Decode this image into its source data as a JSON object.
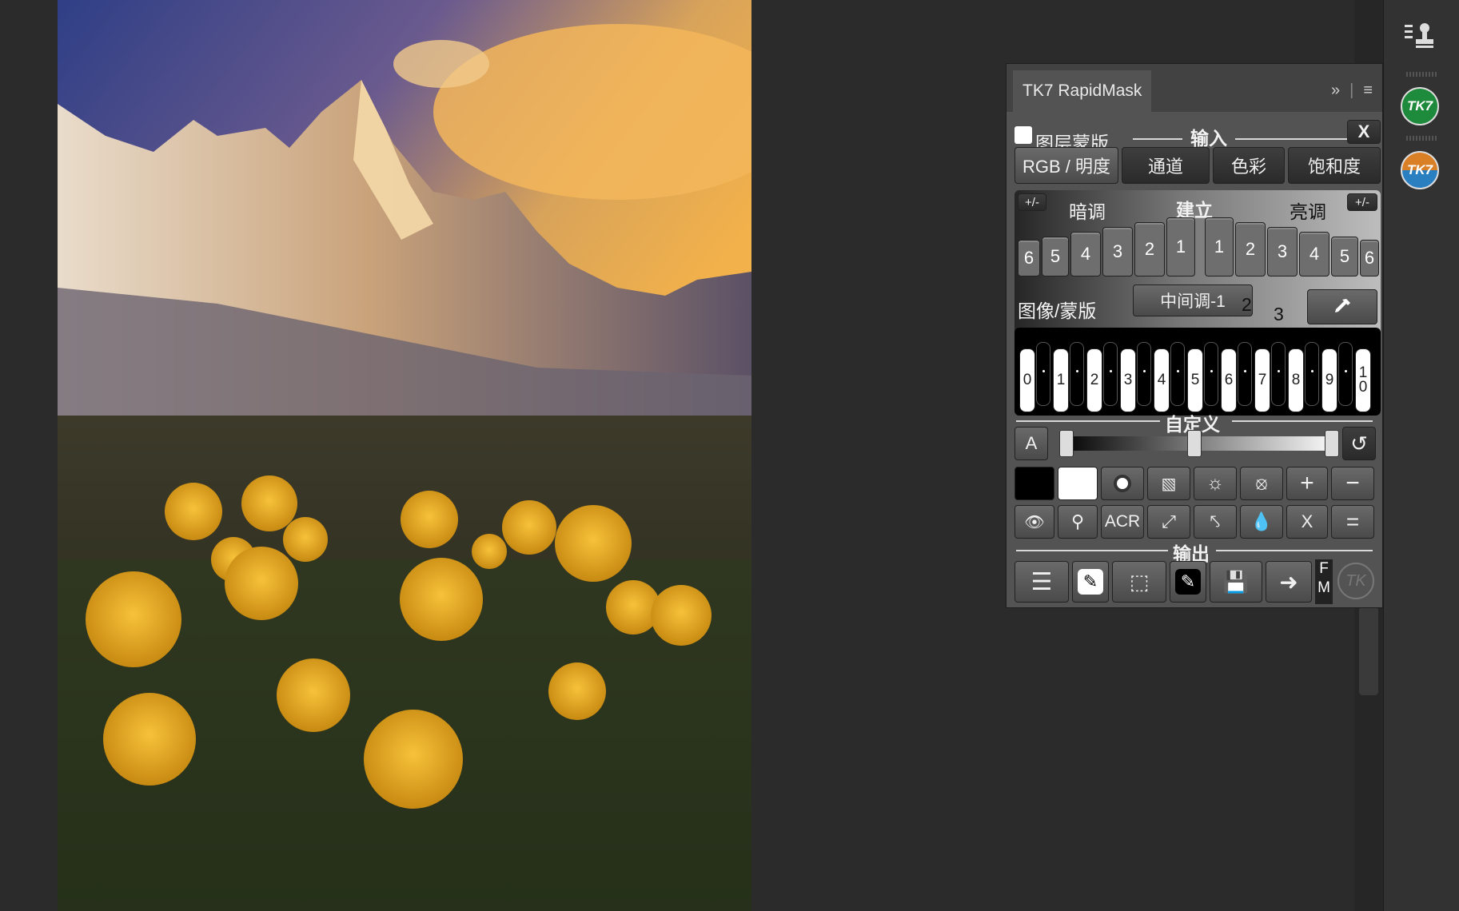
{
  "panel": {
    "tab_title": "TK7 RapidMask",
    "expand_icon": "double-chevron-right-icon",
    "menu_icon": "hamburger-menu-icon"
  },
  "input_section": {
    "layer_mask_label": "图层蒙版",
    "layer_mask_checked": false,
    "heading": "输入",
    "close_label": "X",
    "rgb_luminosity_label": "RGB / 明度",
    "channel_label": "通道",
    "color_label": "色彩",
    "saturation_label": "饱和度"
  },
  "build_section": {
    "plusminus_left": "+/-",
    "plusminus_right": "+/-",
    "shadows_label": "暗调",
    "build_label": "建立",
    "highlights_label": "亮调",
    "shadow_keys": [
      "6",
      "5",
      "4",
      "3",
      "2",
      "1"
    ],
    "highlight_keys": [
      "1",
      "2",
      "3",
      "4",
      "5",
      "6"
    ],
    "image_mask_label": "图像/蒙版",
    "midtone_label": "中间调-1",
    "midtone_2": "2",
    "midtone_3": "3",
    "piano_keys": [
      "0",
      "1",
      "2",
      "3",
      "4",
      "5",
      "6",
      "7",
      "8",
      "9",
      "1\n0"
    ]
  },
  "custom_section": {
    "heading": "自定义",
    "auto_label": "A",
    "acr_label": "ACR",
    "x_label": "X",
    "equals_label": "=",
    "plus_label": "+",
    "minus_label": "−"
  },
  "output_section": {
    "heading": "输出",
    "fm_f": "F",
    "fm_m": "M",
    "logo_text": "TK"
  },
  "dock": {
    "tk7_badge_top": "TK7",
    "tk7_badge_bottom": "TK7",
    "colors": {
      "green": "#1e8a3c",
      "orange": "#d97f26",
      "blue": "#2a7fc0"
    }
  }
}
